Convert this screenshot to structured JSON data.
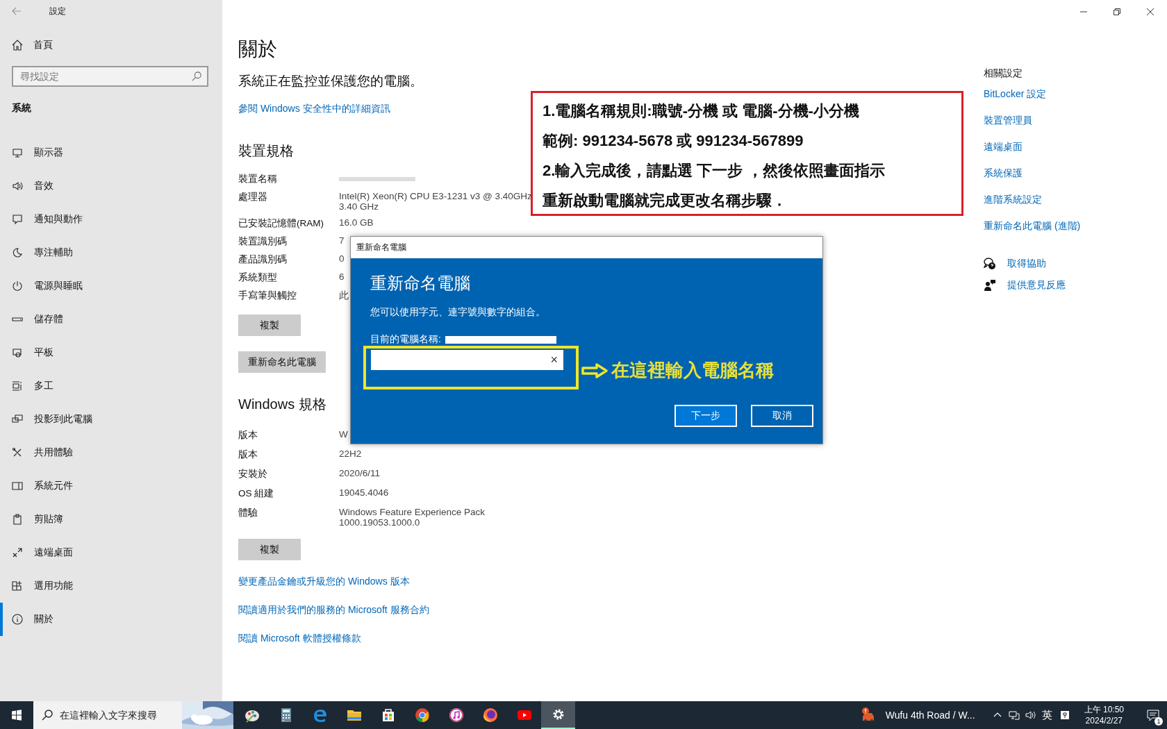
{
  "window": {
    "title": "設定"
  },
  "sidebar": {
    "home": "首頁",
    "search": {
      "placeholder": "尋找設定"
    },
    "section": "系統",
    "items": [
      {
        "label": "顯示器",
        "selected": false
      },
      {
        "label": "音效",
        "selected": false
      },
      {
        "label": "通知與動作",
        "selected": false
      },
      {
        "label": "專注輔助",
        "selected": false
      },
      {
        "label": "電源與睡眠",
        "selected": false
      },
      {
        "label": "儲存體",
        "selected": false
      },
      {
        "label": "平板",
        "selected": false
      },
      {
        "label": "多工",
        "selected": false
      },
      {
        "label": "投影到此電腦",
        "selected": false
      },
      {
        "label": "共用體驗",
        "selected": false
      },
      {
        "label": "系統元件",
        "selected": false
      },
      {
        "label": "剪貼簿",
        "selected": false
      },
      {
        "label": "遠端桌面",
        "selected": false
      },
      {
        "label": "選用功能",
        "selected": false
      },
      {
        "label": "關於",
        "selected": true
      }
    ]
  },
  "main": {
    "title": "關於",
    "status": "系統正在監控並保護您的電腦。",
    "security_link": "參閱 Windows 安全性中的詳細資訊",
    "device_specs": {
      "heading": "裝置規格",
      "rows": [
        {
          "label": "裝置名稱",
          "redacted": true
        },
        {
          "label": "處理器",
          "value": "Intel(R) Xeon(R) CPU E3-1231 v3 @ 3.40GHz 3.40 GHz"
        },
        {
          "label": "已安裝記憶體(RAM)",
          "value": "16.0 GB"
        },
        {
          "label": "裝置識別碼",
          "value": "7"
        },
        {
          "label": "產品識別碼",
          "value": "0"
        },
        {
          "label": "系統類型",
          "value": "6"
        },
        {
          "label": "手寫筆與觸控",
          "value": "此"
        }
      ]
    },
    "copy_button": "複製",
    "rename_button": "重新命名此電腦",
    "windows_specs": {
      "heading": "Windows 規格",
      "rows": [
        {
          "label": "版本",
          "value": "W"
        },
        {
          "label": "版本",
          "value": "22H2"
        },
        {
          "label": "安裝於",
          "value": "2020/6/11"
        },
        {
          "label": "OS 組建",
          "value": "19045.4046"
        },
        {
          "label": "體驗",
          "value": "Windows Feature Experience Pack 1000.19053.1000.0"
        }
      ]
    },
    "copy_button_2": "複製",
    "links": [
      "變更產品金鑰或升級您的 Windows 版本",
      "閱讀適用於我們的服務的 Microsoft 服務合約",
      "閱讀 Microsoft 軟體授權條款"
    ]
  },
  "related": {
    "heading": "相關設定",
    "links": [
      "BitLocker 設定",
      "裝置管理員",
      "遠端桌面",
      "系統保護",
      "進階系統設定",
      "重新命名此電腦 (進階)"
    ],
    "help": [
      {
        "kind": "help",
        "label": "取得協助"
      },
      {
        "kind": "feedback",
        "label": "提供意見反應"
      }
    ]
  },
  "annotation": {
    "lines": [
      "1.電腦名稱規則:職號-分機 或 電腦-分機-小分機",
      "範例: 991234-5678 或 991234-567899",
      "2.輸入完成後，請點選 下一步 ，然後依照畫面指示",
      "重新啟動電腦就完成更改名稱步驟．"
    ]
  },
  "dialog": {
    "title": "重新命名電腦",
    "heading": "重新命名電腦",
    "description": "您可以使用字元、連字號與數字的組合。",
    "current_name_label": "目前的電腦名稱:",
    "clear": "×",
    "buttons": [
      {
        "label": "下一步",
        "primary": true
      },
      {
        "label": "取消",
        "primary": false
      }
    ]
  },
  "pointer": {
    "label": "在這裡輸入電腦名稱"
  },
  "taskbar": {
    "search": {
      "placeholder": "在這裡輸入文字來搜尋"
    },
    "apps": [
      {
        "selected": false
      },
      {
        "selected": false
      },
      {
        "selected": false
      },
      {
        "selected": false
      },
      {
        "selected": false
      },
      {
        "selected": false
      },
      {
        "selected": false
      },
      {
        "selected": false
      },
      {
        "selected": false
      },
      {
        "selected": true
      }
    ],
    "weather": "Wufu 4th Road / W...",
    "ime": "英",
    "time": "上午 10:50",
    "date": "2024/2/27",
    "notifications": "1"
  }
}
